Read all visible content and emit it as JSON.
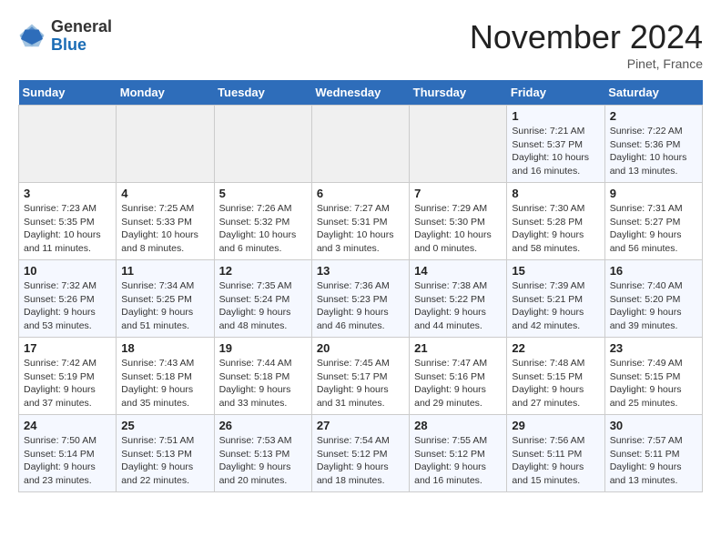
{
  "logo": {
    "general": "General",
    "blue": "Blue"
  },
  "header": {
    "month": "November 2024",
    "location": "Pinet, France"
  },
  "weekdays": [
    "Sunday",
    "Monday",
    "Tuesday",
    "Wednesday",
    "Thursday",
    "Friday",
    "Saturday"
  ],
  "weeks": [
    [
      {
        "day": "",
        "info": ""
      },
      {
        "day": "",
        "info": ""
      },
      {
        "day": "",
        "info": ""
      },
      {
        "day": "",
        "info": ""
      },
      {
        "day": "",
        "info": ""
      },
      {
        "day": "1",
        "info": "Sunrise: 7:21 AM\nSunset: 5:37 PM\nDaylight: 10 hours and 16 minutes."
      },
      {
        "day": "2",
        "info": "Sunrise: 7:22 AM\nSunset: 5:36 PM\nDaylight: 10 hours and 13 minutes."
      }
    ],
    [
      {
        "day": "3",
        "info": "Sunrise: 7:23 AM\nSunset: 5:35 PM\nDaylight: 10 hours and 11 minutes."
      },
      {
        "day": "4",
        "info": "Sunrise: 7:25 AM\nSunset: 5:33 PM\nDaylight: 10 hours and 8 minutes."
      },
      {
        "day": "5",
        "info": "Sunrise: 7:26 AM\nSunset: 5:32 PM\nDaylight: 10 hours and 6 minutes."
      },
      {
        "day": "6",
        "info": "Sunrise: 7:27 AM\nSunset: 5:31 PM\nDaylight: 10 hours and 3 minutes."
      },
      {
        "day": "7",
        "info": "Sunrise: 7:29 AM\nSunset: 5:30 PM\nDaylight: 10 hours and 0 minutes."
      },
      {
        "day": "8",
        "info": "Sunrise: 7:30 AM\nSunset: 5:28 PM\nDaylight: 9 hours and 58 minutes."
      },
      {
        "day": "9",
        "info": "Sunrise: 7:31 AM\nSunset: 5:27 PM\nDaylight: 9 hours and 56 minutes."
      }
    ],
    [
      {
        "day": "10",
        "info": "Sunrise: 7:32 AM\nSunset: 5:26 PM\nDaylight: 9 hours and 53 minutes."
      },
      {
        "day": "11",
        "info": "Sunrise: 7:34 AM\nSunset: 5:25 PM\nDaylight: 9 hours and 51 minutes."
      },
      {
        "day": "12",
        "info": "Sunrise: 7:35 AM\nSunset: 5:24 PM\nDaylight: 9 hours and 48 minutes."
      },
      {
        "day": "13",
        "info": "Sunrise: 7:36 AM\nSunset: 5:23 PM\nDaylight: 9 hours and 46 minutes."
      },
      {
        "day": "14",
        "info": "Sunrise: 7:38 AM\nSunset: 5:22 PM\nDaylight: 9 hours and 44 minutes."
      },
      {
        "day": "15",
        "info": "Sunrise: 7:39 AM\nSunset: 5:21 PM\nDaylight: 9 hours and 42 minutes."
      },
      {
        "day": "16",
        "info": "Sunrise: 7:40 AM\nSunset: 5:20 PM\nDaylight: 9 hours and 39 minutes."
      }
    ],
    [
      {
        "day": "17",
        "info": "Sunrise: 7:42 AM\nSunset: 5:19 PM\nDaylight: 9 hours and 37 minutes."
      },
      {
        "day": "18",
        "info": "Sunrise: 7:43 AM\nSunset: 5:18 PM\nDaylight: 9 hours and 35 minutes."
      },
      {
        "day": "19",
        "info": "Sunrise: 7:44 AM\nSunset: 5:18 PM\nDaylight: 9 hours and 33 minutes."
      },
      {
        "day": "20",
        "info": "Sunrise: 7:45 AM\nSunset: 5:17 PM\nDaylight: 9 hours and 31 minutes."
      },
      {
        "day": "21",
        "info": "Sunrise: 7:47 AM\nSunset: 5:16 PM\nDaylight: 9 hours and 29 minutes."
      },
      {
        "day": "22",
        "info": "Sunrise: 7:48 AM\nSunset: 5:15 PM\nDaylight: 9 hours and 27 minutes."
      },
      {
        "day": "23",
        "info": "Sunrise: 7:49 AM\nSunset: 5:15 PM\nDaylight: 9 hours and 25 minutes."
      }
    ],
    [
      {
        "day": "24",
        "info": "Sunrise: 7:50 AM\nSunset: 5:14 PM\nDaylight: 9 hours and 23 minutes."
      },
      {
        "day": "25",
        "info": "Sunrise: 7:51 AM\nSunset: 5:13 PM\nDaylight: 9 hours and 22 minutes."
      },
      {
        "day": "26",
        "info": "Sunrise: 7:53 AM\nSunset: 5:13 PM\nDaylight: 9 hours and 20 minutes."
      },
      {
        "day": "27",
        "info": "Sunrise: 7:54 AM\nSunset: 5:12 PM\nDaylight: 9 hours and 18 minutes."
      },
      {
        "day": "28",
        "info": "Sunrise: 7:55 AM\nSunset: 5:12 PM\nDaylight: 9 hours and 16 minutes."
      },
      {
        "day": "29",
        "info": "Sunrise: 7:56 AM\nSunset: 5:11 PM\nDaylight: 9 hours and 15 minutes."
      },
      {
        "day": "30",
        "info": "Sunrise: 7:57 AM\nSunset: 5:11 PM\nDaylight: 9 hours and 13 minutes."
      }
    ]
  ]
}
